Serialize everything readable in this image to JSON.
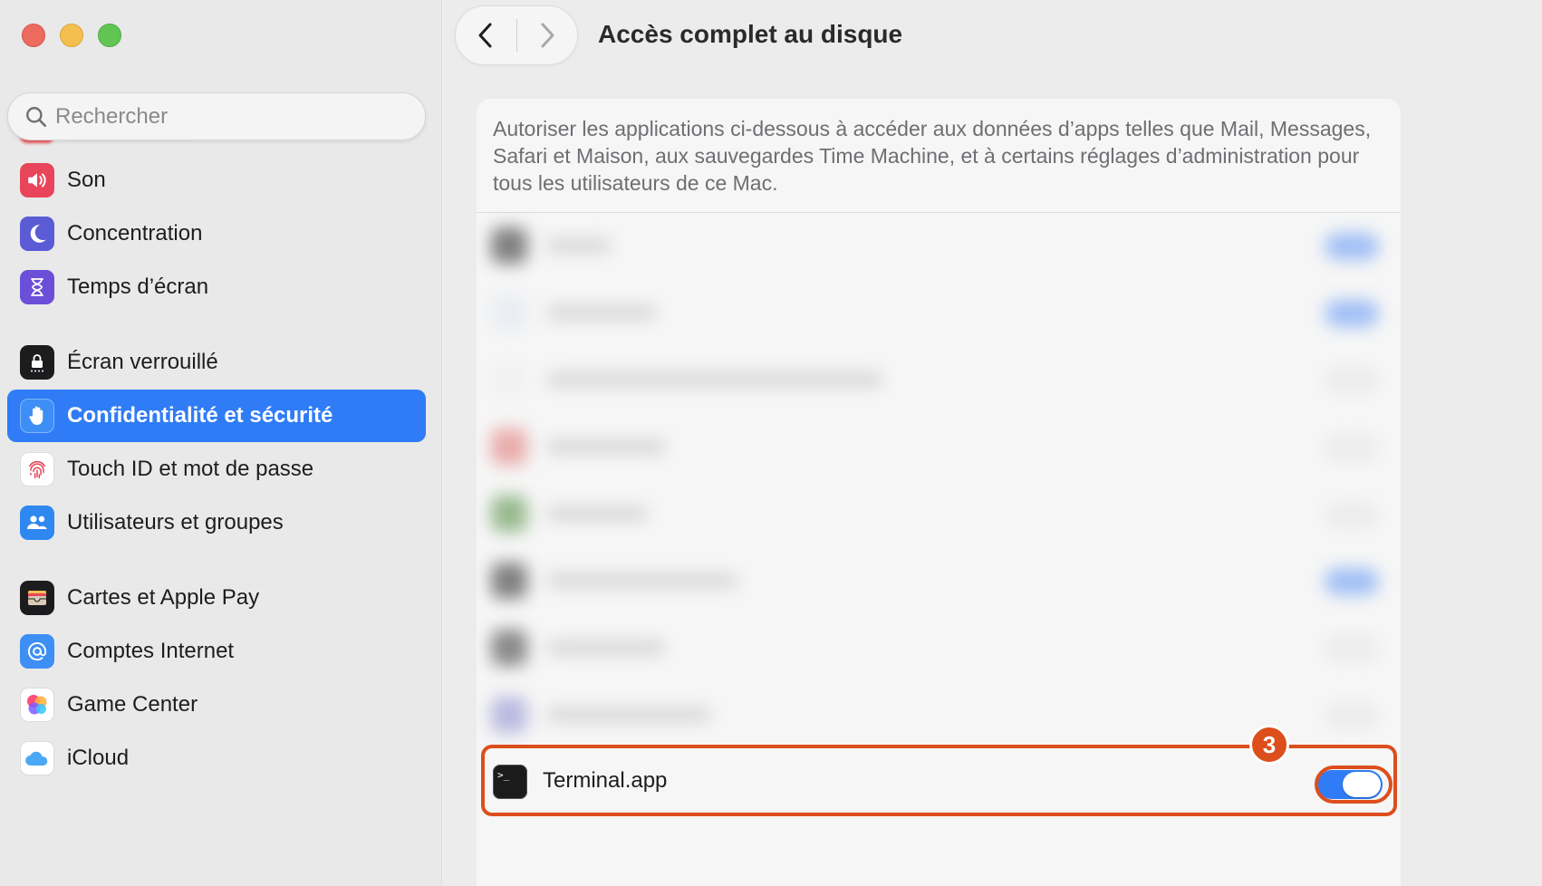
{
  "window": {
    "title": "Accès complet au disque"
  },
  "search": {
    "placeholder": "Rechercher"
  },
  "sidebar": {
    "items": [
      {
        "label": "Son",
        "icon": "speaker-icon",
        "color": "#e8455a"
      },
      {
        "label": "Concentration",
        "icon": "moon-icon",
        "color": "#5b5bd6"
      },
      {
        "label": "Temps d’écran",
        "icon": "hourglass-icon",
        "color": "#6b4fd8"
      },
      {
        "label": "Écran verrouillé",
        "icon": "lock-icon",
        "color": "#1c1c1e"
      },
      {
        "label": "Confidentialité et sécurité",
        "icon": "hand-icon",
        "color": "#2f7cf6",
        "selected": true
      },
      {
        "label": "Touch ID et mot de passe",
        "icon": "fingerprint-icon",
        "color": "#ffffff"
      },
      {
        "label": "Utilisateurs et groupes",
        "icon": "users-icon",
        "color": "#2f88f0"
      },
      {
        "label": "Cartes et Apple Pay",
        "icon": "wallet-icon",
        "color": "#1c1c1e"
      },
      {
        "label": "Comptes Internet",
        "icon": "at-icon",
        "color": "#3d8ff5"
      },
      {
        "label": "Game Center",
        "icon": "game-center-icon",
        "color": "#ffffff"
      },
      {
        "label": "iCloud",
        "icon": "cloud-icon",
        "color": "#ffffff"
      }
    ]
  },
  "main": {
    "description": "Autoriser les applications ci-dessous à accéder aux données d’apps telles que Mail, Messages, Safari et Maison, aux sauvegardes Time Machine, et à certains réglages d’administration pour tous les utilisateurs de ce Mac.",
    "terminal": {
      "label": "Terminal.app",
      "icon_text": ">_",
      "enabled": true
    },
    "annotation": {
      "step": "3",
      "color": "#dc4e1c"
    }
  },
  "colors": {
    "accent": "#2f7cf6",
    "annotation": "#dc4e1c"
  }
}
